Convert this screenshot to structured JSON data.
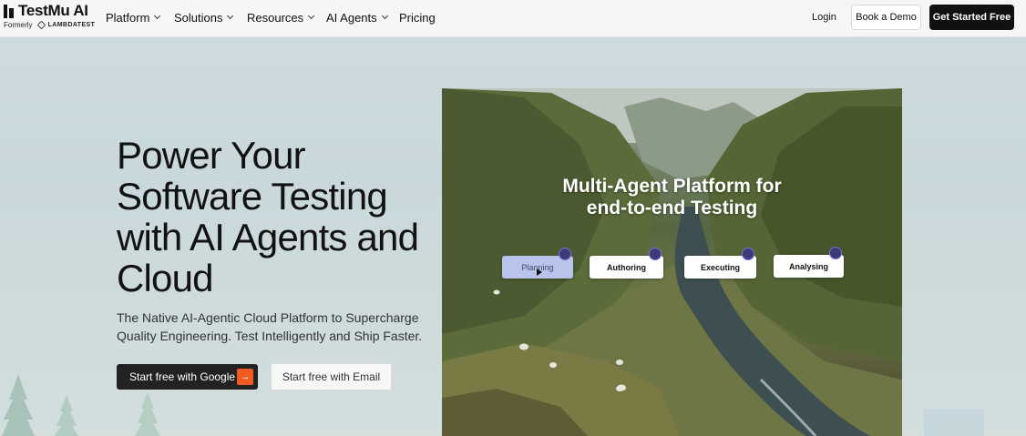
{
  "brand": {
    "name": "TestMu AI",
    "formerly_label": "Formerly",
    "formerly_name": "LAMBDATEST"
  },
  "nav": {
    "items": [
      {
        "label": "Platform",
        "has_dropdown": true
      },
      {
        "label": "Solutions",
        "has_dropdown": true
      },
      {
        "label": "Resources",
        "has_dropdown": true
      },
      {
        "label": "AI Agents",
        "has_dropdown": true
      },
      {
        "label": "Pricing",
        "has_dropdown": false
      }
    ],
    "login": "Login",
    "book_demo": "Book a Demo",
    "get_started": "Get Started Free"
  },
  "hero": {
    "title": "Power Your Software Testing with AI Agents and Cloud",
    "subtitle": "The Native AI-Agentic Cloud Platform to Supercharge Quality Engineering. Test Intelligently and Ship Faster.",
    "cta_google": "Start free with Google",
    "cta_google_icon": "arrow-right-icon",
    "cta_email": "Start free with Email"
  },
  "video": {
    "title_line1": "Multi-Agent Platform for",
    "title_line2": "end-to-end Testing",
    "steps": [
      {
        "label": "Planning",
        "active": true
      },
      {
        "label": "Authoring",
        "active": false
      },
      {
        "label": "Executing",
        "active": false
      },
      {
        "label": "Analysing",
        "active": false
      }
    ]
  },
  "colors": {
    "accent": "#f15a24",
    "dark": "#111111",
    "active_step": "#b9c4ec"
  }
}
